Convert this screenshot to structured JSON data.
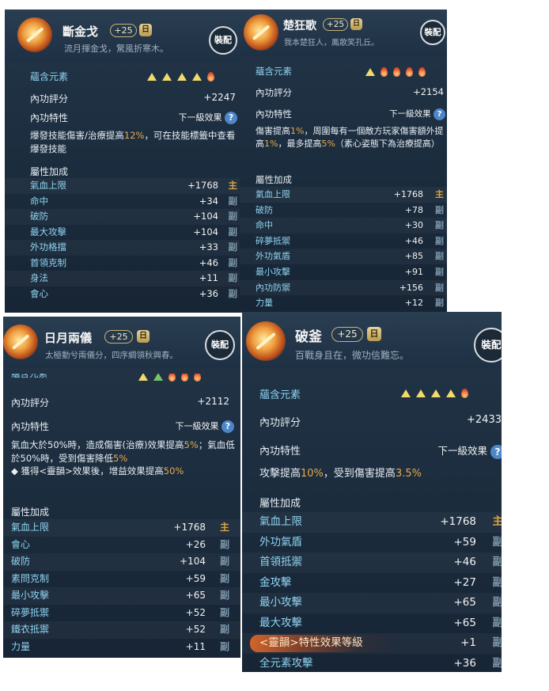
{
  "panels": [
    {
      "name": "斷金戈",
      "level": "+25",
      "symbol": "日",
      "subtitle": "流月揮金戈，驚風折寒木。",
      "equip": "裝配",
      "element_label": "蘊含元素",
      "element_icons": [
        "metal-triangle-icon",
        "metal-triangle-icon",
        "metal-triangle-icon",
        "metal-triangle-icon",
        "fire-icon"
      ],
      "score_label": "內功評分",
      "score_value": "+2247",
      "trait_label": "內功特性",
      "trait_hint": "下一級效果",
      "trait_text_a": "爆發技能傷害/治療提高",
      "trait_pct": "12%",
      "trait_text_b": "，可在技能標籤中查看爆發技能",
      "attr_label": "屬性加成",
      "stats": [
        {
          "name": "氣血上限",
          "value": "+1768",
          "tag": "主"
        },
        {
          "name": "命中",
          "value": "+34",
          "tag": "副"
        },
        {
          "name": "破防",
          "value": "+104",
          "tag": "副"
        },
        {
          "name": "最大攻擊",
          "value": "+104",
          "tag": "副"
        },
        {
          "name": "外功格擋",
          "value": "+33",
          "tag": "副"
        },
        {
          "name": "首領克制",
          "value": "+46",
          "tag": "副"
        },
        {
          "name": "身法",
          "value": "+11",
          "tag": "副"
        },
        {
          "name": "會心",
          "value": "+36",
          "tag": "副"
        }
      ]
    },
    {
      "name": "楚狂歌",
      "level": "+25",
      "symbol": "日",
      "subtitle": "我本楚狂人，鳳歌笑孔丘。",
      "equip": "裝配",
      "element_label": "蘊含元素",
      "element_icons": [
        "metal-triangle-icon",
        "fire-icon",
        "fire-icon",
        "fire-icon",
        "fire-icon"
      ],
      "score_label": "內功評分",
      "score_value": "+2154",
      "trait_label": "內功特性",
      "trait_hint": "下一級效果",
      "trait_text_a": "傷害提高",
      "trait_pct": "1%",
      "trait_text_b": "，周圍每有一個敵方玩家傷害額外提高",
      "trait_pct2": "1%",
      "trait_text_c": "，最多提高",
      "trait_pct3": "5%",
      "trait_text_d": "（素心姿態下為治療提高）",
      "attr_label": "屬性加成",
      "stats": [
        {
          "name": "氣血上限",
          "value": "+1768",
          "tag": "主"
        },
        {
          "name": "破防",
          "value": "+78",
          "tag": "副"
        },
        {
          "name": "命中",
          "value": "+30",
          "tag": "副"
        },
        {
          "name": "碎夢抵禦",
          "value": "+46",
          "tag": "副"
        },
        {
          "name": "外功氣盾",
          "value": "+85",
          "tag": "副"
        },
        {
          "name": "最小攻擊",
          "value": "+91",
          "tag": "副"
        },
        {
          "name": "內功防禦",
          "value": "+156",
          "tag": "副"
        },
        {
          "name": "力量",
          "value": "+12",
          "tag": "副"
        }
      ]
    },
    {
      "name": "日月兩儀",
      "level": "+25",
      "symbol": "日",
      "subtitle": "太極動兮兩儀分，四序綢領秋興春。",
      "equip": "裝配",
      "element_label": "蘊含元素",
      "element_icons": [
        "metal-triangle-icon",
        "wood-triangle-icon",
        "fire-icon",
        "fire-icon",
        "fire-icon"
      ],
      "score_label": "內功評分",
      "score_value": "+2112",
      "trait_label": "內功特性",
      "trait_hint": "下一級效果",
      "trait_text_a": "氣血大於50%時，造成傷害(治療)效果提高",
      "trait_pct": "5%",
      "trait_text_b": "；氣血低於50%時，受到傷害降低",
      "trait_pct2": "5%",
      "trait_bullet": "◆ 獲得<靈韻>效果後，增益效果提高",
      "trait_pct3": "50%",
      "attr_label": "屬性加成",
      "stats": [
        {
          "name": "氣血上限",
          "value": "+1768",
          "tag": "主"
        },
        {
          "name": "會心",
          "value": "+26",
          "tag": "副"
        },
        {
          "name": "破防",
          "value": "+104",
          "tag": "副"
        },
        {
          "name": "素問克制",
          "value": "+59",
          "tag": "副"
        },
        {
          "name": "最小攻擊",
          "value": "+65",
          "tag": "副"
        },
        {
          "name": "碎夢抵禦",
          "value": "+52",
          "tag": "副"
        },
        {
          "name": "鐵衣抵禦",
          "value": "+52",
          "tag": "副"
        },
        {
          "name": "力量",
          "value": "+11",
          "tag": "副"
        }
      ]
    },
    {
      "name": "破釜",
      "level": "+25",
      "symbol": "日",
      "subtitle": "百戰身且在，微功信難忘。",
      "equip": "裝配",
      "element_label": "蘊含元素",
      "element_icons": [
        "metal-triangle-icon",
        "metal-triangle-icon",
        "metal-triangle-icon",
        "metal-triangle-icon",
        "fire-icon"
      ],
      "score_label": "內功評分",
      "score_value": "+2433",
      "trait_label": "內功特性",
      "trait_hint": "下一級效果",
      "trait_text_a": "攻擊提高",
      "trait_pct": "10%",
      "trait_text_b": "，受到傷害提高",
      "trait_pct2": "3.5%",
      "attr_label": "屬性加成",
      "stats": [
        {
          "name": "氣血上限",
          "value": "+1768",
          "tag": "主"
        },
        {
          "name": "外功氣盾",
          "value": "+59",
          "tag": "副"
        },
        {
          "name": "首領抵禦",
          "value": "+46",
          "tag": "副"
        },
        {
          "name": "金攻擊",
          "value": "+27",
          "tag": "副"
        },
        {
          "name": "最小攻擊",
          "value": "+65",
          "tag": "副"
        },
        {
          "name": "最大攻擊",
          "value": "+65",
          "tag": "副"
        },
        {
          "name": "<靈韻>特性效果等級",
          "value": "+1",
          "tag": "副"
        },
        {
          "name": "全元素攻擊",
          "value": "+36",
          "tag": "副"
        }
      ]
    }
  ]
}
